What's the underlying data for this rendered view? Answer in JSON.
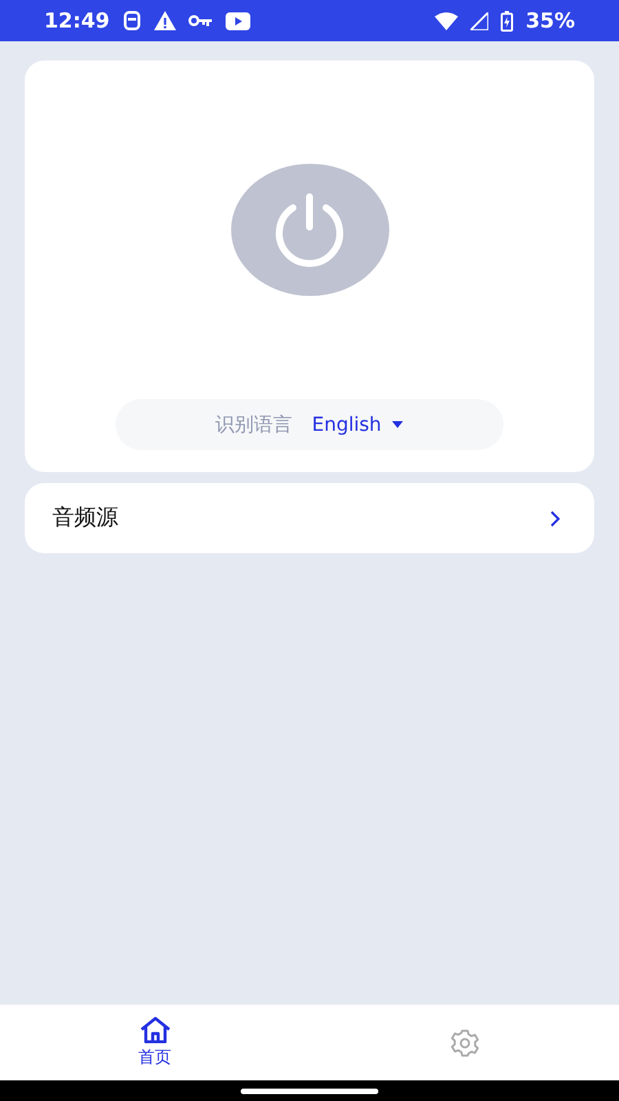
{
  "status_bar": {
    "time": "12:49",
    "battery": "35%"
  },
  "power": {
    "on": false
  },
  "language": {
    "label": "识别语言",
    "value": "English"
  },
  "audio_source": {
    "label": "音频源"
  },
  "tabs": [
    {
      "kind": "home",
      "label": "首页",
      "selected": true
    },
    {
      "kind": "settings",
      "selected": false
    }
  ]
}
